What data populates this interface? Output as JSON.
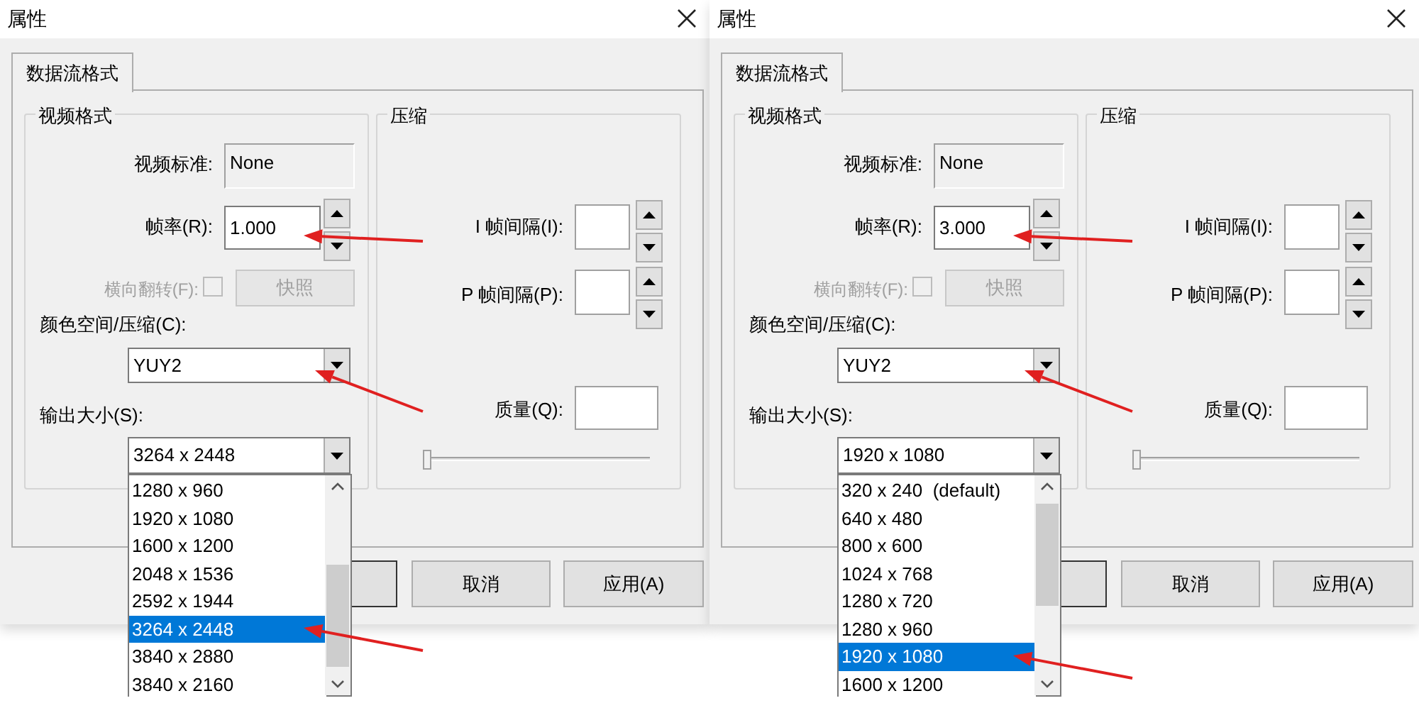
{
  "dialogs": [
    {
      "title": "属性",
      "tab": {
        "label": "数据流格式",
        "selected": true
      },
      "video_format": {
        "legend": "视频格式",
        "standard_label": "视频标准:",
        "standard_value": "None",
        "frame_rate_label": "帧率(R):",
        "frame_rate_value": "1.000",
        "flip_label": "横向翻转(F):",
        "flip": {
          "checked": false,
          "disabled": true
        },
        "snapshot_button": {
          "label": "快照",
          "disabled": true
        },
        "color_label": "颜色空间/压缩(C):",
        "color_value": "YUY2",
        "output_label": "输出大小(S):",
        "output_value": "3264 x 2448",
        "options": [
          {
            "label": "1280 x 960",
            "selected": false
          },
          {
            "label": "1920 x 1080",
            "selected": false
          },
          {
            "label": "1600 x 1200",
            "selected": false
          },
          {
            "label": "2048 x 1536",
            "selected": false
          },
          {
            "label": "2592 x 1944",
            "selected": false
          },
          {
            "label": "3264 x 2448",
            "selected": true
          },
          {
            "label": "3840 x 2880",
            "selected": false
          },
          {
            "label": "3840 x 2160",
            "selected": false
          }
        ]
      },
      "compression": {
        "legend": "压缩",
        "i_frame_label": "I 帧间隔(I):",
        "p_frame_label": "P 帧间隔(P):",
        "quality_label": "质量(Q):",
        "quality_slider": {
          "level": 0
        }
      },
      "buttons": [
        {
          "label": "取消"
        },
        {
          "label": "应用(A)"
        }
      ],
      "annotations": [
        {
          "kind": "frame_rate"
        },
        {
          "kind": "color_space"
        },
        {
          "kind": "selected_size"
        }
      ]
    },
    {
      "title": "属性",
      "tab": {
        "label": "数据流格式",
        "selected": true
      },
      "video_format": {
        "legend": "视频格式",
        "standard_label": "视频标准:",
        "standard_value": "None",
        "frame_rate_label": "帧率(R):",
        "frame_rate_value": "3.000",
        "flip_label": "横向翻转(F):",
        "flip": {
          "checked": false,
          "disabled": true
        },
        "snapshot_button": {
          "label": "快照",
          "disabled": true
        },
        "color_label": "颜色空间/压缩(C):",
        "color_value": "YUY2",
        "output_label": "输出大小(S):",
        "output_value": "1920 x 1080",
        "options": [
          {
            "label": "320 x 240  (default)",
            "selected": false
          },
          {
            "label": "640 x 480",
            "selected": false
          },
          {
            "label": "800 x 600",
            "selected": false
          },
          {
            "label": "1024 x 768",
            "selected": false
          },
          {
            "label": "1280 x 720",
            "selected": false
          },
          {
            "label": "1280 x 960",
            "selected": false
          },
          {
            "label": "1920 x 1080",
            "selected": true
          },
          {
            "label": "1600 x 1200",
            "selected": false
          }
        ]
      },
      "compression": {
        "legend": "压缩",
        "i_frame_label": "I 帧间隔(I):",
        "p_frame_label": "P 帧间隔(P):",
        "quality_label": "质量(Q):",
        "quality_slider": {
          "level": 0
        }
      },
      "buttons": [
        {
          "label": "取消"
        },
        {
          "label": "应用(A)"
        }
      ],
      "annotations": [
        {
          "kind": "frame_rate"
        },
        {
          "kind": "color_space"
        },
        {
          "kind": "selected_size"
        }
      ]
    }
  ]
}
